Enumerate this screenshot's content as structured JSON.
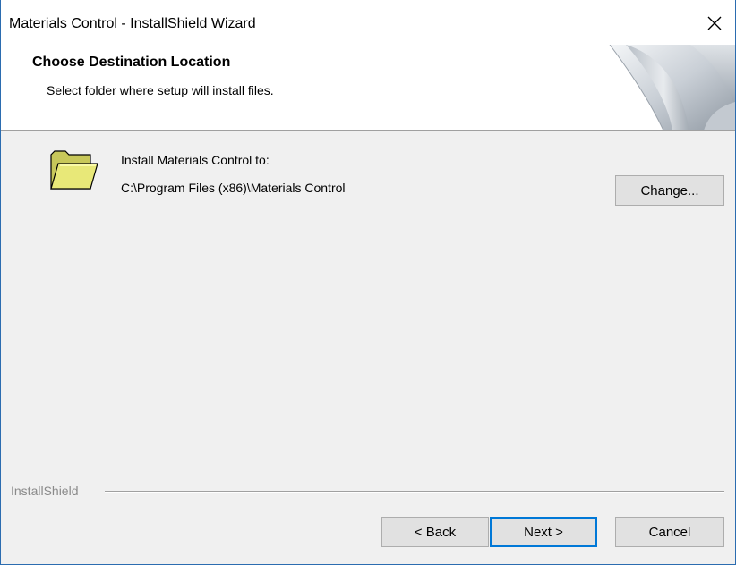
{
  "window": {
    "title": "Materials Control - InstallShield Wizard",
    "close_icon": "close-icon"
  },
  "header": {
    "title": "Choose Destination Location",
    "subtitle": "Select folder where setup will install files.",
    "art_icon": "page-curl-graphic"
  },
  "destination": {
    "folder_icon": "folder-icon",
    "label": "Install Materials Control to:",
    "path": "C:\\Program Files (x86)\\Materials Control",
    "change_label": "Change..."
  },
  "footer": {
    "brand": "InstallShield",
    "back_label": "< Back",
    "next_label": "Next >",
    "cancel_label": "Cancel"
  },
  "colors": {
    "window_border": "#2b6cb0",
    "body_background": "#f0f0f0",
    "focus_border": "#0078d7",
    "folder_yellow": "#e8e878"
  }
}
